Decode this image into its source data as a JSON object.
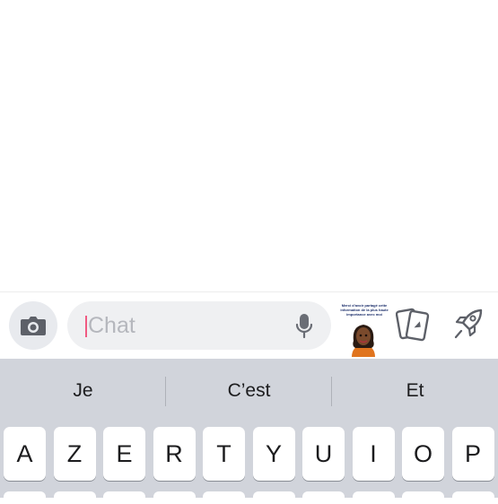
{
  "composer": {
    "placeholder": "Chat",
    "sticker_caption": "Merci d'avoir partagé cette information de la plus haute importance avec moi"
  },
  "keyboard": {
    "suggestions": [
      "Je",
      "C’est",
      "Et"
    ],
    "row1": [
      "A",
      "Z",
      "E",
      "R",
      "T",
      "Y",
      "U",
      "I",
      "O",
      "P"
    ]
  },
  "colors": {
    "caret": "#f05a82",
    "keyboard_bg": "#d1d4db",
    "input_bg": "#eff0f2"
  }
}
